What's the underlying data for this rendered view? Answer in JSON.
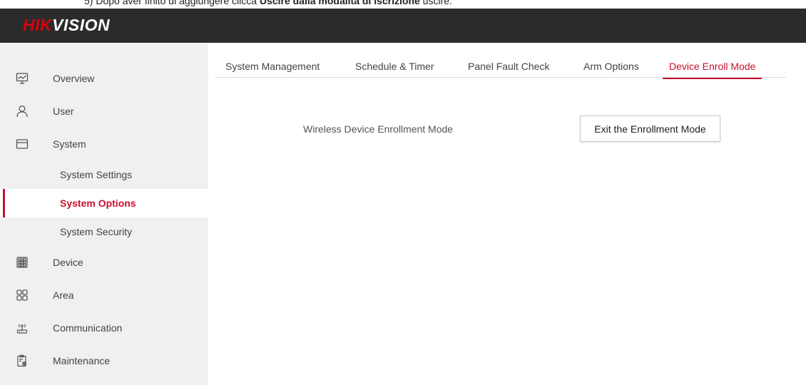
{
  "document_caption": {
    "prefix": "5) Dopo aver finito di aggiungere clicca ",
    "bold": "Uscire dalla modalità di iscrizione",
    "suffix": " uscire."
  },
  "header": {
    "logo_red": "HIK",
    "logo_white": "VISION",
    "accent_color": "#d7000f",
    "bar_color": "#2b2b2b"
  },
  "sidebar": {
    "items": [
      {
        "label": "Overview",
        "icon": "monitor-icon"
      },
      {
        "label": "User",
        "icon": "user-icon"
      },
      {
        "label": "System",
        "icon": "window-icon"
      },
      {
        "label": "Device",
        "icon": "grid-icon"
      },
      {
        "label": "Area",
        "icon": "squares-icon"
      },
      {
        "label": "Communication",
        "icon": "antenna-icon"
      },
      {
        "label": "Maintenance",
        "icon": "clipboard-gear-icon"
      }
    ],
    "system_subitems": [
      {
        "label": "System Settings",
        "active": false
      },
      {
        "label": "System Options",
        "active": true
      },
      {
        "label": "System Security",
        "active": false
      }
    ]
  },
  "tabs": [
    {
      "label": "System Management",
      "active": false
    },
    {
      "label": "Schedule & Timer",
      "active": false
    },
    {
      "label": "Panel Fault Check",
      "active": false
    },
    {
      "label": "Arm Options",
      "active": false
    },
    {
      "label": "Device Enroll Mode",
      "active": true
    }
  ],
  "content": {
    "field_label": "Wireless Device Enrollment Mode",
    "exit_button": "Exit the Enrollment Mode"
  },
  "colors": {
    "active_red": "#c8102e",
    "sidebar_bg": "#f0f0f0"
  }
}
